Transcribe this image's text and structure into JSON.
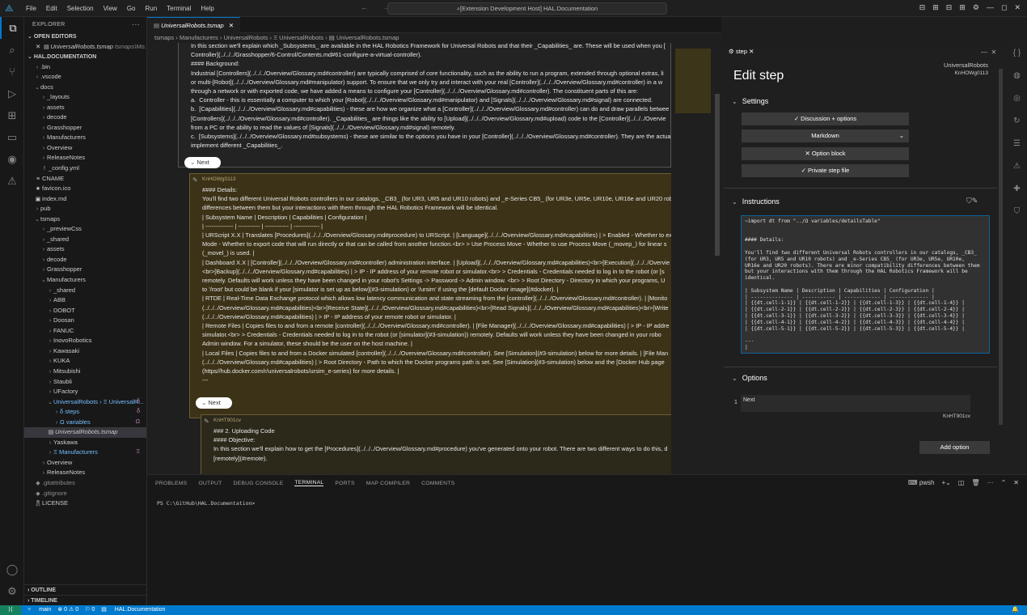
{
  "titlebar": {
    "menu": [
      "File",
      "Edit",
      "Selection",
      "View",
      "Go",
      "Run",
      "Terminal",
      "Help"
    ],
    "command_center": "[Extension Development Host] HAL.Documentation",
    "nav_arrows": "←  →",
    "window_controls": [
      "⊟",
      "⊞",
      "⊟",
      "⊞",
      "⚙",
      "—",
      "◻",
      "✕"
    ]
  },
  "explorer": {
    "title": "EXPLORER",
    "open_editors_label": "OPEN EDITORS",
    "open_editor_file": "UniversalRobots.tsmap",
    "open_editor_path": "tsmaps\\Mo...",
    "workspace_label": "HAL.DOCUMENTATION",
    "tree": [
      {
        "depth": 1,
        "type": "folder",
        "label": ".bin"
      },
      {
        "depth": 1,
        "type": "folder",
        "label": ".vscode"
      },
      {
        "depth": 1,
        "type": "folder-open",
        "label": "docs"
      },
      {
        "depth": 2,
        "type": "folder",
        "label": "_layouts"
      },
      {
        "depth": 2,
        "type": "folder",
        "label": "assets"
      },
      {
        "depth": 2,
        "type": "folder",
        "label": "decode"
      },
      {
        "depth": 2,
        "type": "folder",
        "label": "Grasshopper"
      },
      {
        "depth": 2,
        "type": "folder",
        "label": "Manufacturers"
      },
      {
        "depth": 2,
        "type": "folder",
        "label": "Overview"
      },
      {
        "depth": 2,
        "type": "folder",
        "label": "ReleaseNotes"
      },
      {
        "depth": 2,
        "type": "file",
        "label": "_config.yml",
        "icon": "!"
      },
      {
        "depth": 1,
        "type": "file",
        "label": "CNAME",
        "icon": "≡"
      },
      {
        "depth": 1,
        "type": "file",
        "label": "favicon.ico",
        "icon": "★"
      },
      {
        "depth": 1,
        "type": "file",
        "label": "index.md",
        "icon": "▣"
      },
      {
        "depth": 1,
        "type": "folder",
        "label": "pub"
      },
      {
        "depth": 1,
        "type": "folder-open",
        "label": "tsmaps"
      },
      {
        "depth": 2,
        "type": "folder",
        "label": "_previewCss"
      },
      {
        "depth": 2,
        "type": "folder",
        "label": "_shared"
      },
      {
        "depth": 2,
        "type": "folder",
        "label": "assets"
      },
      {
        "depth": 2,
        "type": "folder",
        "label": "decode"
      },
      {
        "depth": 2,
        "type": "folder",
        "label": "Grasshopper"
      },
      {
        "depth": 2,
        "type": "folder-open",
        "label": "Manufacturers"
      },
      {
        "depth": 3,
        "type": "folder",
        "label": "_shared"
      },
      {
        "depth": 3,
        "type": "folder",
        "label": "ABB"
      },
      {
        "depth": 3,
        "type": "folder",
        "label": "DOBOT"
      },
      {
        "depth": 3,
        "type": "folder",
        "label": "Doosan"
      },
      {
        "depth": 3,
        "type": "folder",
        "label": "FANUC"
      },
      {
        "depth": 3,
        "type": "folder",
        "label": "InovoRobotics"
      },
      {
        "depth": 3,
        "type": "folder",
        "label": "Kawasaki"
      },
      {
        "depth": 3,
        "type": "folder",
        "label": "KUKA"
      },
      {
        "depth": 3,
        "type": "folder",
        "label": "Mitsubishi"
      },
      {
        "depth": 3,
        "type": "folder",
        "label": "Staubli"
      },
      {
        "depth": 3,
        "type": "folder",
        "label": "UFactory"
      },
      {
        "depth": 3,
        "type": "folder-open",
        "label": "UniversalRobots › Ξ UniversalR...",
        "style": "blue",
        "badge": "δ"
      },
      {
        "depth": 4,
        "type": "folder",
        "label": "δ steps",
        "style": "blue",
        "badge": "δ"
      },
      {
        "depth": 4,
        "type": "folder",
        "label": "Ω variables",
        "style": "blue",
        "badge": "Ω"
      },
      {
        "depth": 3,
        "type": "file",
        "label": "UniversalRobots.tsmap",
        "icon": "▤",
        "selected": true
      },
      {
        "depth": 3,
        "type": "folder",
        "label": "Yaskawa"
      },
      {
        "depth": 3,
        "type": "folder",
        "label": "Ξ Manufacturers",
        "style": "blue",
        "badge": "Ξ"
      },
      {
        "depth": 2,
        "type": "folder",
        "label": "Overview"
      },
      {
        "depth": 2,
        "type": "folder",
        "label": "ReleaseNotes"
      },
      {
        "depth": 1,
        "type": "file",
        "label": ".gitattributes",
        "icon": "◆",
        "style": "gray"
      },
      {
        "depth": 1,
        "type": "file",
        "label": ".gitignore",
        "icon": "◆",
        "style": "gray"
      },
      {
        "depth": 1,
        "type": "file",
        "label": "LICENSE",
        "icon": "🎗"
      }
    ],
    "outline_label": "OUTLINE",
    "timeline_label": "TIMELINE"
  },
  "editor": {
    "tab_label": "UniversalRobots.tsmap",
    "breadcrumb": "tsmaps › Manufacturers › UniversalRobots › Ξ UniversalRobots › ▤ UniversalRobots.tsmap",
    "cell1_text": "In this section we'll explain which _Subsystems_ are available in the HAL Robotics Framework for Universal Robots and that their _Capabilities_ are. These will be used when you [\nController](../../../Grasshopper/6-Control/Contents.md#61-configure-a-virtual-controller).\n#### Background:\nIndustrial [Controllers](../../../Overview/Glossary.md#controller) are typically comprised of core functionality, such as the ability to run a program, extended through optional extras, li\nor multi-[Robot](../../../Overview/Glossary.md#manipulator) support. To ensure that we only try and interact with your real [Controller](../../../Overview/Glossary.md#controller) in a w\nthrough a network or with exported code, we have added a means to configure your [Controller](../../../Overview/Glossary.md#controller). The constituent parts of this are:\na.  Controller - this is essentially a computer to which your [Robot](../../../Overview/Glossary.md#manipulator) and [Signals](../../../Overview/Glossary.md#signal) are connected.\nb.  [Capabilities](../../../Overview/Glossary.md#capabilities) - these are how we organize what a [Controller](../../../Overview/Glossary.md#controller) can do and draw parallels betwee\n[Controllers](../../../Overview/Glossary.md#controller). _Capabilities_ are things like the ability to [Upload](../../../Overview/Glossary.md#upload) code to the [Controller](../../../Overvie\nfrom a PC or the ability to read the values of [Signals](../../../Overview/Glossary.md#signal) remotely.\nc.  [Subsystems](../../../Overview/Glossary.md#subsystems) - these are similar to the options you have in your [Controller](../../../Overview/Glossary.md#controller). They are the actua\nimplement different _Capabilities_.",
    "next_label_1": "Next",
    "cell2_id": "KnHOWg0113",
    "cell2_text": "#### Details:\nYou'll find two different Universal Robots controllers in our catalogs, _CB3_ (for UR3, UR5 and UR10 robots) and _e-Series CB5_ (for UR3e, UR5e, UR10e, UR16e and UR20 robots)\ndifferences between them but your interactions with them through the HAL Robotics Framework will be identical.\n| Subsystem Name | Description | Capabilities | Configuration |\n| -------------- | ----------- | ------------ | ------------- |\n| URScript X.X | Translates [Procedures](../../../Overview/Glossary.md#procedure) to URScript. | [Language](../../../Overview/Glossary.md#capabilities) | > Enabled - Whether to exp\nMode - Whether to export code that will run directly or that can be called from another function.<br> > Use Process Move - Whether to use Process Move (_movep_) for linear s\n(_movel_) is used. |\n| Dashboard X.X | [Controller](../../../Overview/Glossary.md#controller) administration interface. | [Upload](../../../Overview/Glossary.md#capabilities)<br>[Execution](../../../Overvie\n<br>[Backup](../../../Overview/Glossary.md#capabilities) | > IP - IP address of your remote robot or simulator.<br> > Credentials - Credentials needed to log in to the robot (or [s\nremotely. Defaults will work unless they have been changed in your robot's Settings -> Password -> Admin window. <br> > Root Directory - Directory in which your programs, U\nto '/root' but could be blank if your [simulator is set up as below](#3-simulation) or '/ursim' if using the [default Docker image](#docker). |\n| RTDE | Real-Time Data Exchange protocol which allows low latency communication and state streaming from the [controller](../../../Overview/Glossary.md#controller). | [Monito\n(../../../Overview/Glossary.md#capabilities)<br>[Receive State](../../../Overview/Glossary.md#capabilities)<br>[Read Signals](../../../Overview/Glossary.md#capabilities)<br>[Write\n(../../../Overview/Glossary.md#capabilities) | > IP - IP address of your remote robot or simulator. |\n| Remote Files | Copies files to and from a remote [controller](../../../Overview/Glossary.md#controller). | [File Manager](../../../Overview/Glossary.md#capabilities) | > IP - IP addre\nsimulator.<br> > Credentials - Credentials needed to log in to the robot (or [simulator](#3-simulation)) remotely. Defaults will work unless they have been changed in your robo\nAdmin window. For a simulator, these should be the user on the host machine. |\n| Local Files | Copies files to and from a Docker simulated [controller](../../../Overview/Glossary.md#controller). See [Simulation](#3-simulation) below for more details. | [File Man\n(../../../Overview/Glossary.md#capabilities) | > Root Directory - Path to which the Docker programs path is set. See [Simulation](#3-simulation) below and the [Docker Hub page\n(https//hub.docker.com/r/universalrobots/ursim_e-series) for more details. |\n---",
    "next_label_2": "Next",
    "cell3_id": "KnHT901cv",
    "cell3_text": "### 2. Uploading Code\n#### Objective:\nIn this section we'll explain how to get the [Procedures](../../../Overview/Glossary.md#procedure) you've generated onto your robot. There are two different ways to do this, d\n[remotely](#remote)."
  },
  "step_panel": {
    "tab_label": "step",
    "heading": "Edit step",
    "owner": "UniversalRobots",
    "step_id": "KnHOWg0113",
    "settings_label": "Settings",
    "settings_buttons": [
      "✓ Discussion + options",
      "Markdown",
      "✕ Option block",
      "✓ Private step file"
    ],
    "instructions_label": "Instructions",
    "instructions_code": "~import dt from \"../Ω variables/detailsTable\"\n\n\n#### Details:\n\nYou'll find two different Universal Robots controllers in our catalogs, _CB3_\n(for UR3, UR5 and UR10 robots) and _e-Series CB5_ (for UR3e, UR5e, UR10e,\nUR16e and UR20 robots). There are minor compatibility differences between them\nbut your interactions with them through the HAL Robotics Framework will be\nidentical.\n\n| Subsystem Name | Description | Capabilities | Configuration |\n| -------------- | ----------- | ------------ | ------------- |\n| {{dt.cell-1-1}} | {{dt.cell-1-2}} | {{dt.cell-1-3}} | {{dt.cell-1-4}} |\n| {{dt.cell-2-1}} | {{dt.cell-2-2}} | {{dt.cell-2-3}} | {{dt.cell-2-4}} |\n| {{dt.cell-3-1}} | {{dt.cell-3-2}} | {{dt.cell-3-3}} | {{dt.cell-3-4}} |\n| {{dt.cell-4-1}} | {{dt.cell-4-2}} | {{dt.cell-4-3}} | {{dt.cell-4-4}} |\n| {{dt.cell-5-1}} | {{dt.cell-5-2}} | {{dt.cell-5-3}} | {{dt.cell-5-4}} |\n\n---\n|",
    "options_label": "Options",
    "option_index": "1",
    "option_text": "Next",
    "option_target": "KnHT901cv",
    "add_option_label": "Add option"
  },
  "bottom_panel": {
    "tabs": [
      "PROBLEMS",
      "OUTPUT",
      "DEBUG CONSOLE",
      "TERMINAL",
      "PORTS",
      "MAP COMPILER",
      "COMMENTS"
    ],
    "active_tab": "TERMINAL",
    "shell_label": "pwsh",
    "terminal_line": "PS C:\\GitHub\\HAL.Documentation>"
  },
  "statusbar": {
    "branch": "main",
    "problems": "⊗ 0 ⚠ 0",
    "ports": "⚐ 0",
    "workspace": "HAL.Documentation"
  },
  "colors": {
    "accent": "#0078d4",
    "status": "#007acc",
    "cell_border": "#6b5d34"
  }
}
